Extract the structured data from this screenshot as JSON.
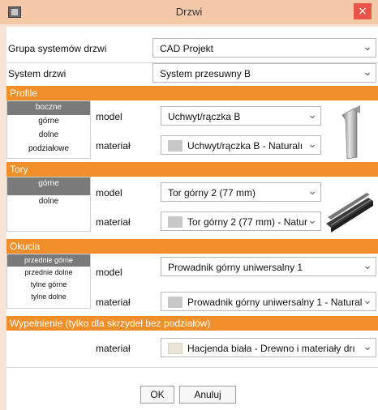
{
  "window": {
    "title": "Drzwi",
    "close": "×"
  },
  "fields": {
    "grupa": {
      "label": "Grupa systemów drzwi",
      "value": "CAD Projekt"
    },
    "system": {
      "label": "System drzwi",
      "value": "System przesuwny B"
    }
  },
  "sections": {
    "profile": {
      "title": "Profile",
      "subitems": [
        "boczne",
        "górne",
        "dolne",
        "podziałowe"
      ],
      "selected": "boczne",
      "model_label": "model",
      "model_value": "Uchwyt/rączka B",
      "material_label": "materiał",
      "material_value": "Uchwyt/rączka B - Naturalı"
    },
    "tory": {
      "title": "Tory",
      "subitems": [
        "górne",
        "dolne"
      ],
      "selected": "górne",
      "model_label": "model",
      "model_value": "Tor górny 2 (77 mm)",
      "material_label": "materiał",
      "material_value": "Tor górny 2 (77 mm) - Natur"
    },
    "okucia": {
      "title": "Okucia",
      "subitems": [
        "przednie górne",
        "przednie dolne",
        "tylne górne",
        "tylne dolne"
      ],
      "selected": "przednie górne",
      "model_label": "model",
      "model_value": "Prowadnik górny uniwersalny 1",
      "material_label": "materiał",
      "material_value": "Prowadnik górny uniwersalny 1 - Natural"
    },
    "wypelnienie": {
      "title": "Wypełnienie (tylko dla skrzydeł bez podziałów)",
      "material_label": "materiał",
      "material_value": "Hacjenda biała - Drewno i materiały drı"
    }
  },
  "buttons": {
    "ok": "OK",
    "cancel": "Anuluj"
  },
  "colors": {
    "accent": "#f08f2a",
    "titlebar": "#f4c8a9",
    "close": "#e8554a",
    "selected_subitem": "#7a7a7a"
  }
}
